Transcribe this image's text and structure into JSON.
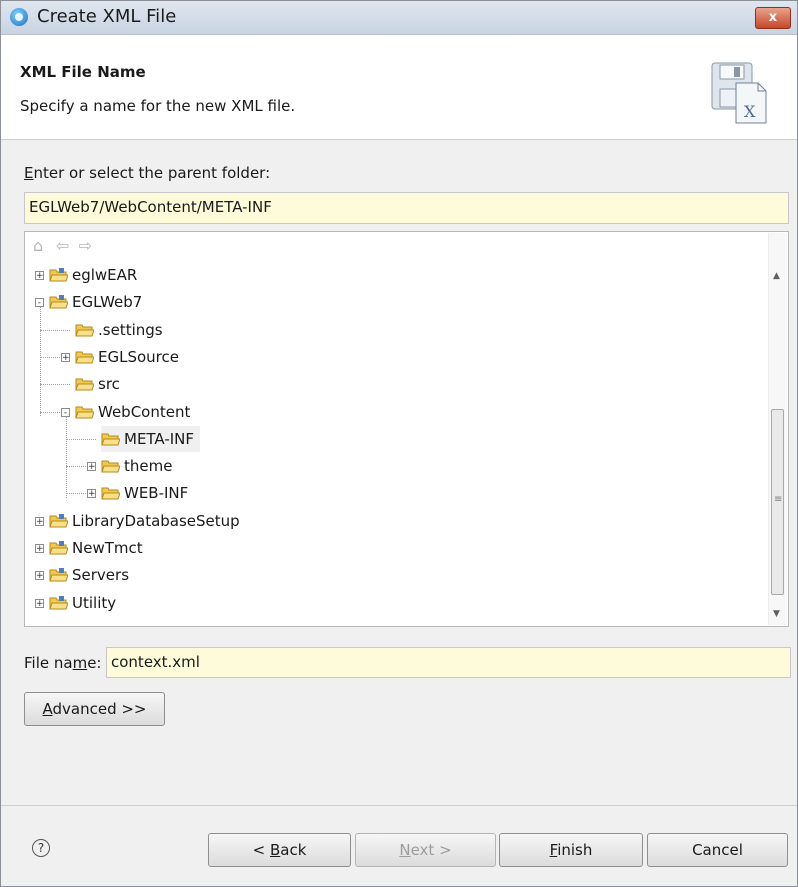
{
  "window": {
    "title": "Create XML File",
    "close_label": "x"
  },
  "header": {
    "title": "XML File Name",
    "description": "Specify a name for the new XML file."
  },
  "parent_folder": {
    "label": "Enter or select the parent folder:",
    "label_mnemonic": "E",
    "label_rest": "nter or select the parent folder:",
    "value": "EGLWeb7/WebContent/META-INF"
  },
  "tree": {
    "nav_icons": [
      "home-icon",
      "back-arrow-icon",
      "forward-arrow-icon"
    ],
    "items": [
      {
        "label": "eglwEAR",
        "level": 0,
        "expander": "+"
      },
      {
        "label": "EGLWeb7",
        "level": 0,
        "expander": "-"
      },
      {
        "label": ".settings",
        "level": 1,
        "expander": ""
      },
      {
        "label": "EGLSource",
        "level": 1,
        "expander": "+"
      },
      {
        "label": "src",
        "level": 1,
        "expander": ""
      },
      {
        "label": "WebContent",
        "level": 1,
        "expander": "-"
      },
      {
        "label": "META-INF",
        "level": 2,
        "expander": "",
        "selected": true
      },
      {
        "label": "theme",
        "level": 2,
        "expander": "+"
      },
      {
        "label": "WEB-INF",
        "level": 2,
        "expander": "+"
      },
      {
        "label": "LibraryDatabaseSetup",
        "level": 0,
        "expander": "+"
      },
      {
        "label": "NewTmct",
        "level": 0,
        "expander": "+"
      },
      {
        "label": "Servers",
        "level": 0,
        "expander": "+"
      },
      {
        "label": "Utility",
        "level": 0,
        "expander": "+"
      }
    ]
  },
  "file_name": {
    "label_pre": "File na",
    "label_mnemonic": "m",
    "label_post": "e:",
    "value": "context.xml"
  },
  "buttons": {
    "advanced": {
      "mnemonic": "A",
      "rest": "dvanced >>"
    },
    "back": {
      "pre": "< ",
      "mnemonic": "B",
      "rest": "ack"
    },
    "next": {
      "mnemonic": "N",
      "rest": "ext >"
    },
    "finish": {
      "mnemonic": "F",
      "rest": "inish"
    },
    "cancel": "Cancel"
  },
  "help_glyph": "?",
  "colors": {
    "input_bg": "#fdfbd9",
    "folder_yellow": "#f2c94c",
    "title_bar": "#d3dce8",
    "close_red": "#c7472a"
  }
}
